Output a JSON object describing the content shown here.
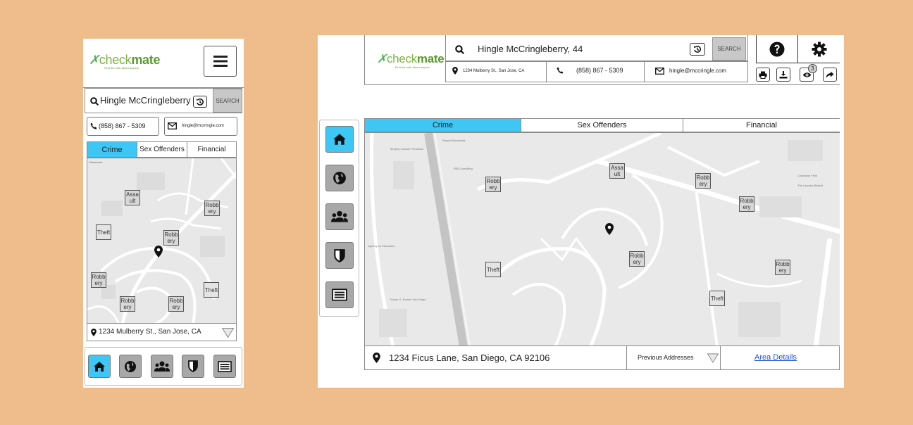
{
  "brand": {
    "logo_prefix": "check",
    "logo_bold": "mate",
    "tagline": "Find the truth about anyone"
  },
  "mobile": {
    "search_value": "Hingle McCringleberry",
    "search_button": "SEARCH",
    "phone": "(858) 867 - 5309",
    "email": "hingle@mcrringle.com",
    "tabs": [
      "Crime",
      "Sex Offenders",
      "Financial"
    ],
    "address": "1234 Mulberry St., San Jose, CA",
    "markers": [
      "Assa ult",
      "Theft",
      "Robb ery",
      "Robb ery",
      "Robb ery",
      "Theft",
      "Robb ery",
      "Robb ery"
    ]
  },
  "desktop": {
    "search_value": "Hingle McCringleberry, 44",
    "search_button": "SEARCH",
    "address_small": "1234 Mulberry St., San Jose, CA",
    "phone": "(858) 867 - 5309",
    "email": "hingle@mccringle.com",
    "views_badge": "3",
    "tabs": [
      "Crime",
      "Sex Offenders",
      "Financial"
    ],
    "address": "1234 Ficus Lane, San Diego, CA 92106",
    "previous_addresses": "Previous Addresses",
    "area_details": "Area Details",
    "markers": [
      "Robb ery",
      "Assa ult",
      "Robb ery",
      "Robb ery",
      "Theft",
      "Robb ery",
      "Robb ery",
      "Theft"
    ]
  },
  "colors": {
    "accent": "#3ec6f4",
    "background": "#efbd8c",
    "brand_green": "#5b9a2e"
  }
}
